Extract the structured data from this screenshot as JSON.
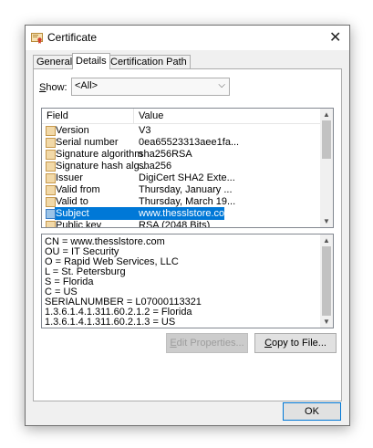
{
  "window": {
    "title": "Certificate",
    "close_glyph": "✕"
  },
  "tabs": [
    {
      "label": "General",
      "active": false
    },
    {
      "label": "Details",
      "active": true
    },
    {
      "label": "Certification Path",
      "active": false
    }
  ],
  "show": {
    "label_prefix": "",
    "label_accel": "S",
    "label_rest": "how:",
    "value": "<All>",
    "arrow": "⌵"
  },
  "fields": {
    "headers": {
      "field": "Field",
      "value": "Value"
    },
    "rows": [
      {
        "field": "Version",
        "value": "V3",
        "selected": false
      },
      {
        "field": "Serial number",
        "value": "0ea65523313aee1fa...",
        "selected": false
      },
      {
        "field": "Signature algorithm",
        "value": "sha256RSA",
        "selected": false
      },
      {
        "field": "Signature hash alg...",
        "value": "sha256",
        "selected": false
      },
      {
        "field": "Issuer",
        "value": "DigiCert SHA2 Exte...",
        "selected": false
      },
      {
        "field": "Valid from",
        "value": "Thursday, January ...",
        "selected": false
      },
      {
        "field": "Valid to",
        "value": "Thursday, March 19...",
        "selected": false
      },
      {
        "field": "Subject",
        "value": "www.thesslstore.co...",
        "selected": true
      },
      {
        "field": "Public key",
        "value": "RSA (2048 Bits)",
        "selected": false
      }
    ],
    "scroll_position": 0.0
  },
  "detail": {
    "lines": [
      "CN = www.thesslstore.com",
      "OU = IT Security",
      "O = Rapid Web Services, LLC",
      "L = St. Petersburg",
      "S = Florida",
      "C = US",
      "SERIALNUMBER = L07000113321",
      "1.3.6.1.4.1.311.60.2.1.2 = Florida",
      "1.3.6.1.4.1.311.60.2.1.3 = US"
    ]
  },
  "buttons": {
    "edit_properties": {
      "accel": "E",
      "rest": "dit Properties..."
    },
    "copy_to_file": {
      "accel": "C",
      "rest": "opy to File..."
    },
    "ok": "OK"
  },
  "colors": {
    "selection": "#0078d7",
    "accent_border": "#0078d7"
  },
  "icons": {
    "title": "certificate-icon",
    "field": "field-icon",
    "close": "close-icon"
  }
}
